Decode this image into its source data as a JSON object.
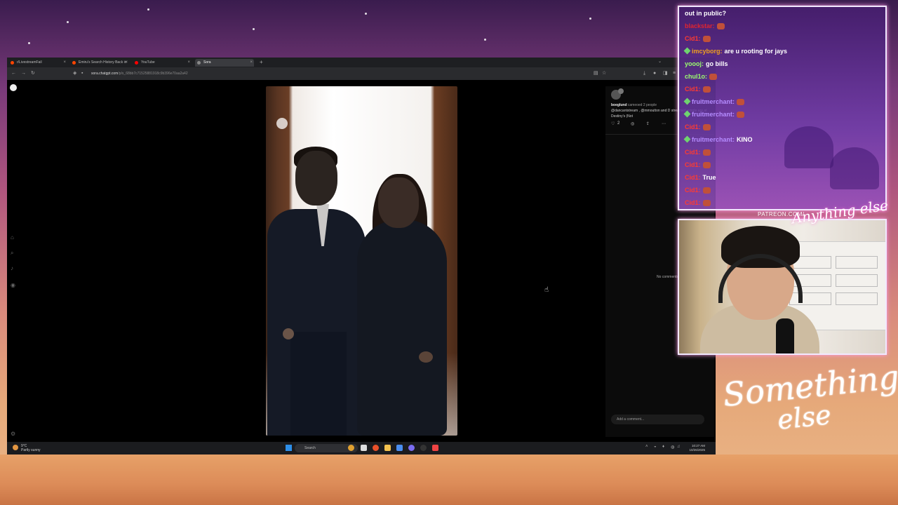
{
  "browser": {
    "tabs": [
      {
        "label": "r/LivestreamFail",
        "color": "#ff4500"
      },
      {
        "label": "Emiru's Search History Back in",
        "color": "#ff4500"
      },
      {
        "label": "YouTube",
        "color": "#ff0000"
      },
      {
        "label": "Sora",
        "color": "#888888"
      }
    ],
    "new_tab": "+",
    "url_host": "sora.chatgpt.com",
    "url_path": "/p/s_68bb7c71525881918c9b396e70aa2a42"
  },
  "post": {
    "username": "boeglund",
    "cameo_text": "cameoed 2 people",
    "caption": "@dancantstream , @mmoutton and D streamer) emote are at Destiny's (Not",
    "likes": "2",
    "no_comments": "No comments yet",
    "comment_placeholder": "Add a comment..."
  },
  "taskbar": {
    "temperature": "9°C",
    "weather": "Partly sunny",
    "search": "Search",
    "time": "10:27 AM",
    "date": "10/26/2025"
  },
  "chat": {
    "messages": [
      {
        "user": "",
        "text": "out in public?",
        "user_color": "#ffffff",
        "emote": false,
        "badge": false
      },
      {
        "user": "blackstar:",
        "text": "",
        "user_color": "#e0242f",
        "emote": true,
        "badge": false
      },
      {
        "user": "Cid1:",
        "text": "",
        "user_color": "#ff3b30",
        "emote": true,
        "badge": false
      },
      {
        "user": "imcyborg:",
        "text": "are u rooting for jays",
        "user_color": "#f0a020",
        "emote": false,
        "badge": true
      },
      {
        "user": "yoooj:",
        "text": "go bills",
        "user_color": "#9cff6e",
        "emote": false,
        "badge": false
      },
      {
        "user": "chul1o:",
        "text": "",
        "user_color": "#9cff6e",
        "emote": true,
        "badge": false
      },
      {
        "user": "Cid1:",
        "text": "",
        "user_color": "#ff3b30",
        "emote": true,
        "badge": false
      },
      {
        "user": "fruitmerchant:",
        "text": "",
        "user_color": "#b58cff",
        "emote": true,
        "badge": true
      },
      {
        "user": "fruitmerchant:",
        "text": "",
        "user_color": "#b58cff",
        "emote": true,
        "badge": true
      },
      {
        "user": "Cid1:",
        "text": "",
        "user_color": "#ff3b30",
        "emote": true,
        "badge": false
      },
      {
        "user": "fruitmerchant:",
        "text": "KINO",
        "user_color": "#b58cff",
        "emote": false,
        "badge": true
      },
      {
        "user": "Cid1:",
        "text": "",
        "user_color": "#ff3b30",
        "emote": true,
        "badge": false
      },
      {
        "user": "Cid1:",
        "text": "",
        "user_color": "#ff3b30",
        "emote": true,
        "badge": false
      },
      {
        "user": "Cid1:",
        "text": "True",
        "user_color": "#ff3b30",
        "emote": false,
        "badge": false
      },
      {
        "user": "Cid1:",
        "text": "",
        "user_color": "#ff3b30",
        "emote": true,
        "badge": false
      },
      {
        "user": "Cid1:",
        "text": "",
        "user_color": "#ff3b30",
        "emote": true,
        "badge": false
      }
    ]
  },
  "overlay": {
    "patreon": "PATREON.COM/",
    "anything": "Anything else",
    "something_1": "Something",
    "something_2": "else"
  }
}
